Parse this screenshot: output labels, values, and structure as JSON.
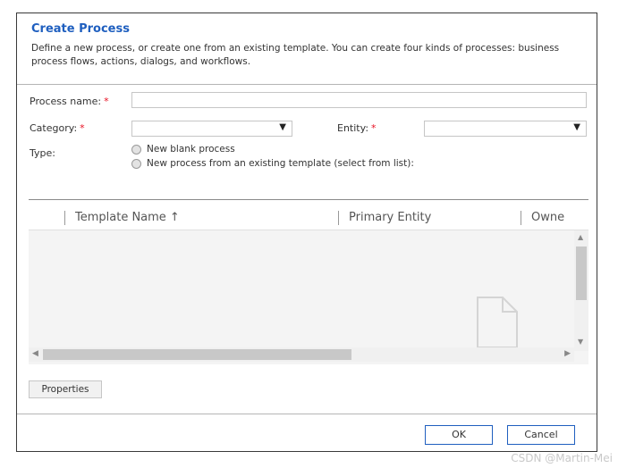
{
  "dialog": {
    "title": "Create Process",
    "description": "Define a new process, or create one from an existing template. You can create four kinds of processes: business process flows, actions, dialogs, and workflows."
  },
  "form": {
    "process_name_label": "Process name:",
    "category_label": "Category:",
    "entity_label": "Entity:",
    "type_label": "Type:",
    "required_marker": "*",
    "process_name_value": "",
    "category_value": "",
    "entity_value": "",
    "type_options": [
      {
        "label": "New blank process",
        "selected": false
      },
      {
        "label": "New process from an existing template (select from list):",
        "selected": false
      }
    ]
  },
  "grid": {
    "columns": [
      "Template Name ↑",
      "Primary Entity",
      "Owne"
    ],
    "rows": []
  },
  "buttons": {
    "properties": "Properties",
    "ok": "OK",
    "cancel": "Cancel"
  },
  "watermark": "CSDN @Martin-Mei",
  "colors": {
    "title": "#1f5fbf",
    "required": "#e81123",
    "button_border": "#1f5fbf"
  }
}
